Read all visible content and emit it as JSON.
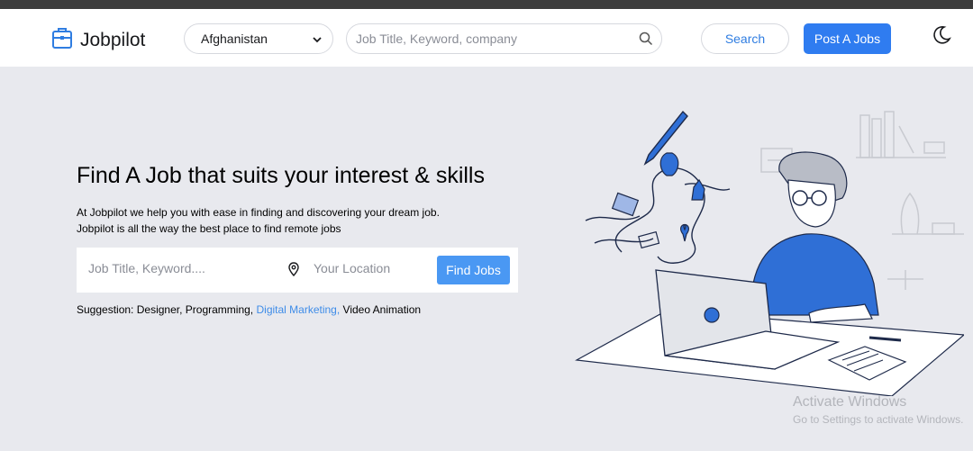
{
  "navbar": {
    "brand": "Jobpilot",
    "country_selected": "Afghanistan",
    "search_placeholder": "Job Title, Keyword, company",
    "search_button": "Search",
    "post_button": "Post A Jobs",
    "icons": [
      "briefcase-icon",
      "chevron-down-icon",
      "search-icon",
      "moon-icon"
    ]
  },
  "hero": {
    "title": "Find A Job that suits your interest & skills",
    "desc_line1": "At Jobpilot we help you with ease in finding and discovering your dream job.",
    "desc_line2": "Jobpilot is all the way the best place to find remote jobs",
    "keyword_placeholder": "Job Title, Keyword....",
    "location_placeholder": "Your Location",
    "find_button": "Find Jobs",
    "suggestion_label": "Suggestion:",
    "suggestions": [
      "Designer,",
      "Programming,",
      "Digital Marketing,",
      "Video Animation"
    ]
  },
  "colors": {
    "accent": "#2f7cf0",
    "find_button": "#4a98f3",
    "link": "#3e8ce8",
    "hero_bg": "#e8e9ee"
  },
  "watermark": {
    "line1": "Activate Windows",
    "line2": "Go to Settings to activate Windows."
  }
}
